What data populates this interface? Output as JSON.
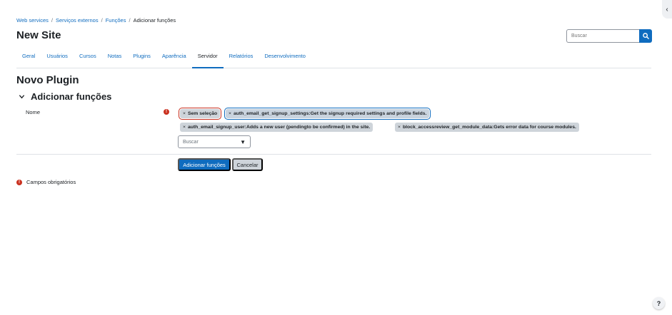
{
  "breadcrumb": [
    {
      "label": "Web services"
    },
    {
      "label": "Serviços externos"
    },
    {
      "label": "Funções"
    },
    {
      "label": "Adicionar funções"
    }
  ],
  "breadcrumb_sep": "/",
  "site_title": "New Site",
  "search": {
    "placeholder": "Buscar"
  },
  "tabs": [
    {
      "label": "Geral"
    },
    {
      "label": "Usuários"
    },
    {
      "label": "Cursos"
    },
    {
      "label": "Notas"
    },
    {
      "label": "Plugins"
    },
    {
      "label": "Aparência"
    },
    {
      "label": "Servidor",
      "active": true
    },
    {
      "label": "Relatórios"
    },
    {
      "label": "Desenvolvimento"
    }
  ],
  "page_heading": "Novo Plugin",
  "section": {
    "title": "Adicionar funções"
  },
  "form": {
    "field_label": "Nome",
    "required_icon": "!",
    "tag_remove": "×",
    "selections": [
      {
        "label": "Sem seleção",
        "state": "error"
      },
      {
        "label": "auth_email_get_signup_settings:Get the signup required settings and profile fields.",
        "state": "focused"
      },
      {
        "label": "auth_email_signup_user:Adds a new user (pendingto be confirmed) in the site."
      },
      {
        "label": "block_accessreview_get_module_data:Gets error data for course modules."
      }
    ],
    "select_placeholder": "Buscar",
    "select_arrow": "▼",
    "submit_label": "Adicionar funções",
    "cancel_label": "Cancelar"
  },
  "required_note": "Campos obrigatórios",
  "help_label": "?",
  "drawer_toggle": "‹",
  "colors": {
    "primary": "#0f6cbf",
    "error": "#ca3120",
    "tag": "#ced4da"
  }
}
